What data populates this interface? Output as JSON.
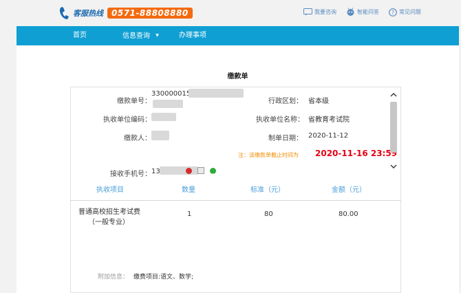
{
  "header": {
    "hotline_label": "客服热线",
    "hotline_number": "0571-88808880",
    "links": [
      {
        "label": "我要咨询",
        "icon": "chat-icon"
      },
      {
        "label": "智能问答",
        "icon": "robot-icon"
      },
      {
        "label": "常见问题",
        "icon": "question-icon"
      }
    ]
  },
  "nav": {
    "items": [
      "首页",
      "信息查询",
      "办理事项"
    ],
    "dropdown_caret": "▼"
  },
  "page": {
    "title": "缴款单"
  },
  "form": {
    "payment_no_label": "缴款单号：",
    "payment_no_value": "330000015",
    "region_label": "行政区划：",
    "region_value": "省本级",
    "unit_code_label": "执收单位编码：",
    "unit_code_value": "",
    "unit_name_label": "执收单位名称：",
    "unit_name_value": "省教育考试院",
    "payer_label": "缴款人：",
    "payer_value": "",
    "date_label": "制单日期：",
    "date_value": "2020-11-12",
    "notice": "注：该缴款单截止时间为",
    "deadline": "2020-11-16 23:59",
    "phone_label": "接收手机号：",
    "phone_value": "13"
  },
  "table": {
    "columns": [
      "执收项目",
      "数量",
      "标准（元）",
      "金额（元）"
    ],
    "rows": [
      {
        "item_line1": "普通高校招生考试费",
        "item_line2": "（一般专业）",
        "qty": "1",
        "standard": "80",
        "amount": "80.00"
      }
    ]
  },
  "extra": {
    "label": "附加信息：",
    "value": "缴费项目:语文、数学;"
  },
  "colors": {
    "nav_bg": "#0f9fd3",
    "hotline_bg": "#f36b10",
    "deadline": "#e60012",
    "notice": "#f08c00",
    "column_header": "#4a9fd8"
  }
}
